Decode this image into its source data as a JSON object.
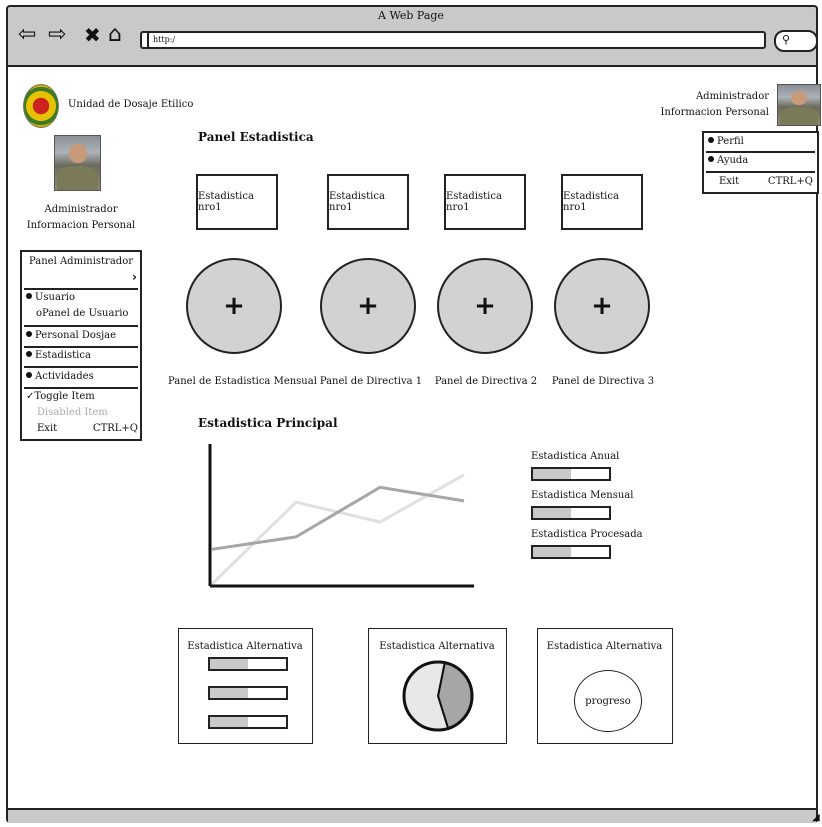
{
  "window": {
    "title": "A Web Page",
    "url": "http:/"
  },
  "brand": {
    "name": "Unidad de Dosaje Etilico"
  },
  "topright": {
    "role": "Administrador",
    "info": "Informacion Personal",
    "menu": [
      {
        "label": "Perfil"
      },
      {
        "label": "Ayuda"
      }
    ],
    "exit": {
      "label": "Exit",
      "shortcut": "CTRL+Q"
    }
  },
  "sidebar": {
    "role": "Administrador",
    "info": "Informacion Personal",
    "menu_title": "Panel Administrador",
    "items": [
      {
        "label": "Usuario",
        "sub": "oPanel de Usuario"
      },
      {
        "label": "Personal Dosjae"
      },
      {
        "label": "Estadistica"
      },
      {
        "label": "Actividades"
      }
    ],
    "toggle": "Toggle Item",
    "disabled": "Disabled Item",
    "exit": {
      "label": "Exit",
      "shortcut": "CTRL+Q"
    }
  },
  "main": {
    "title": "Panel Estadistica",
    "stat_boxes": [
      "Estadistica nro1",
      "Estadistica nro1",
      "Estadistica nro1",
      "Estadistica nro1"
    ],
    "add_symbol": "+",
    "panels": [
      "Panel de Estadistica Mensual",
      "Panel de Directiva 1",
      "Panel de Directiva 2",
      "Panel de Directiva 3"
    ],
    "chart_title": "Estadistica Principal",
    "legend": [
      {
        "label": "Estadistica Anual",
        "progress": 0.5
      },
      {
        "label": "Estadistica Mensual",
        "progress": 0.5
      },
      {
        "label": "Estadistica Procesada",
        "progress": 0.5
      }
    ],
    "alt_panels": [
      {
        "title": "Estadistica Alternativa",
        "bars": [
          0.5,
          0.5,
          0.5
        ]
      },
      {
        "title": "Estadistica Alternativa",
        "pie": [
          0.42,
          0.58
        ]
      },
      {
        "title": "Estadistica Alternativa",
        "label": "progreso"
      }
    ]
  },
  "chart_data": {
    "type": "line",
    "title": "",
    "xlabel": "",
    "ylabel": "",
    "grid": false,
    "series": [
      {
        "values": [
          0.28,
          0.38,
          0.78,
          0.67
        ],
        "color": "#a6a6a6"
      },
      {
        "values": [
          0.0,
          0.66,
          0.5,
          0.88
        ],
        "color": "#e0e0e0"
      }
    ],
    "ylim": [
      0,
      1
    ]
  },
  "colors": {
    "chrome": "#c9c9c9",
    "fill": "#d2d2d2",
    "line_dark": "#a6a6a6",
    "line_light": "#e0e0e0"
  },
  "icons": [
    "back-arrow-icon",
    "forward-arrow-icon",
    "close-icon",
    "home-icon",
    "search-icon",
    "avatar-photo",
    "seal-logo",
    "plus-icon",
    "checkmark-icon",
    "chevron-right-icon",
    "resize-grip-icon"
  ]
}
